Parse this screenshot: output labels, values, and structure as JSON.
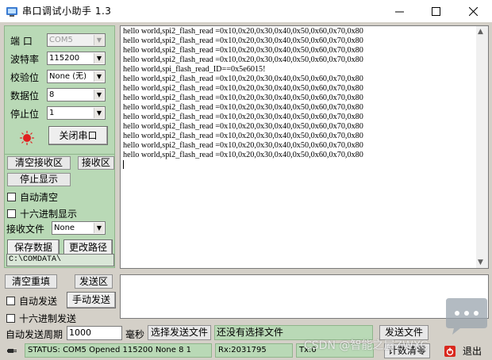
{
  "window": {
    "title": "串口调试小助手 1.3",
    "icon": "serial-tool-icon"
  },
  "settings": {
    "port_label": "端 口",
    "port_value": "COM5",
    "baud_label": "波特率",
    "baud_value": "115200",
    "parity_label": "校验位",
    "parity_value": "None (无)",
    "databits_label": "数据位",
    "databits_value": "8",
    "stopbits_label": "停止位",
    "stopbits_value": "1",
    "close_port_button": "关闭串口",
    "port_status_color": "#e02020"
  },
  "receive_controls": {
    "clear_receive": "清空接收区",
    "receive_area_label": "接收区",
    "stop_display": "停止显示",
    "auto_clear": "自动清空",
    "hex_display": "十六进制显示",
    "receive_file_label": "接收文件",
    "receive_file_value": "None",
    "save_data": "保存数据",
    "change_path": "更改路径",
    "path": "C:\\COMDATA\\"
  },
  "receive_lines": [
    "hello world,spi2_flash_read =0x10,0x20,0x30,0x40,0x50,0x60,0x70,0x80",
    "hello world,spi2_flash_read =0x10,0x20,0x30,0x40,0x50,0x60,0x70,0x80",
    "hello world,spi2_flash_read =0x10,0x20,0x30,0x40,0x50,0x60,0x70,0x80",
    "hello world,spi2_flash_read =0x10,0x20,0x30,0x40,0x50,0x60,0x70,0x80",
    "hello world,spi_flash_read_ID==0x5e6015!",
    "hello world,spi2_flash_read =0x10,0x20,0x30,0x40,0x50,0x60,0x70,0x80",
    "hello world,spi2_flash_read =0x10,0x20,0x30,0x40,0x50,0x60,0x70,0x80",
    "hello world,spi2_flash_read =0x10,0x20,0x30,0x40,0x50,0x60,0x70,0x80",
    "hello world,spi2_flash_read =0x10,0x20,0x30,0x40,0x50,0x60,0x70,0x80",
    "hello world,spi2_flash_read =0x10,0x20,0x30,0x40,0x50,0x60,0x70,0x80",
    "hello world,spi2_flash_read =0x10,0x20,0x30,0x40,0x50,0x60,0x70,0x80",
    "hello world,spi2_flash_read =0x10,0x20,0x30,0x40,0x50,0x60,0x70,0x80",
    "hello world,spi2_flash_read =0x10,0x20,0x30,0x40,0x50,0x60,0x70,0x80",
    "hello world,spi2_flash_read =0x10,0x20,0x30,0x40,0x50,0x60,0x70,0x80",
    ""
  ],
  "send_controls": {
    "clear_resend": "清空重填",
    "send_area_label": "发送区",
    "auto_send": "自动发送",
    "manual_send": "手动发送",
    "hex_send": "十六进制发送",
    "period_label": "自动发送周期",
    "period_value": "1000",
    "ms_label": "毫秒",
    "select_file": "选择发送文件",
    "file_status": "还没有选择文件",
    "send_file": "发送文件"
  },
  "status_bar": {
    "status": "STATUS: COM5 Opened 115200 None  8 1",
    "rx": "Rx:2031795",
    "tx": "Tx:0",
    "count_clear": "计数清零",
    "exit": "退出"
  },
  "watermark": "CSDN @智能之屋ZWXC"
}
